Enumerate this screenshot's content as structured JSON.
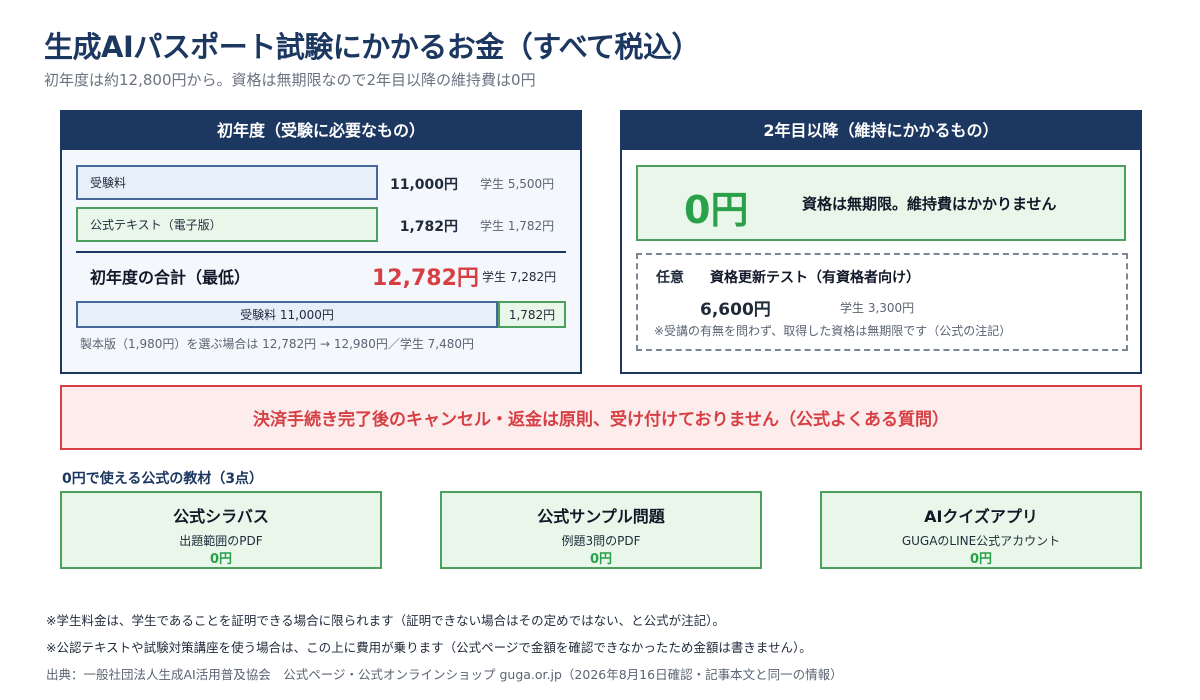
{
  "header": {
    "title": "生成AIパスポート試験にかかるお金（すべて税込）",
    "subtitle": "初年度は約12,800円から。資格は無期限なので2年目以降の維持費は0円"
  },
  "first_year": {
    "heading": "初年度（受験に必要なもの）",
    "items": [
      {
        "label": "受験料",
        "price": "11,000円",
        "student": "学生 5,500円"
      },
      {
        "label": "公式テキスト（電子版）",
        "price": "1,782円",
        "student": "学生 1,782円"
      }
    ],
    "total_label": "初年度の合計（最低）",
    "total_price": "12,782円",
    "total_student": "学生 7,282円",
    "bar_exam_label": "受験料 11,000円",
    "bar_exam_value": 11000,
    "bar_text_label": "1,782円",
    "bar_text_value": 1782,
    "note": "製本版（1,980円）を選ぶ場合は 12,782円 → 12,980円／学生 7,480円"
  },
  "later_years": {
    "heading": "2年目以降（維持にかかるもの）",
    "zero_value": "0円",
    "zero_text": "資格は無期限。維持費はかかりません",
    "optional_tag": "任意",
    "optional_title": "資格更新テスト（有資格者向け）",
    "optional_price": "6,600円",
    "optional_student": "学生 3,300円",
    "optional_note": "※受講の有無を問わず、取得した資格は無期限です（公式の注記）"
  },
  "warning": {
    "text": "決済手続き完了後のキャンセル・返金は原則、受け付けておりません（公式よくある質問）"
  },
  "materials": {
    "heading": "0円で使える公式の教材（3点）",
    "items": [
      {
        "title": "公式シラバス",
        "desc": "出題範囲のPDF",
        "price": "0円"
      },
      {
        "title": "公式サンプル問題",
        "desc": "例題3問のPDF",
        "price": "0円"
      },
      {
        "title": "AIクイズアプリ",
        "desc": "GUGAのLINE公式アカウント",
        "price": "0円"
      }
    ]
  },
  "footer": {
    "note1": "※学生料金は、学生であることを証明できる場合に限られます（証明できない場合はその定めではない、と公式が注記）。",
    "note2": "※公認テキストや試験対策講座を使う場合は、この上に費用が乗ります（公式ページで金額を確認できなかったため金額は書きません）。",
    "source": "出典：一般社団法人生成AI活用普及協会　公式ページ・公式オンラインショップ guga.or.jp（2026年8月16日確認・記事本文と同一の情報）"
  },
  "colors": {
    "navy": "#1c3760",
    "blue_fill": "#e6effa",
    "green_fill": "#e9f7ea",
    "green_accent": "#2aa04a",
    "red_accent": "#d64045"
  }
}
